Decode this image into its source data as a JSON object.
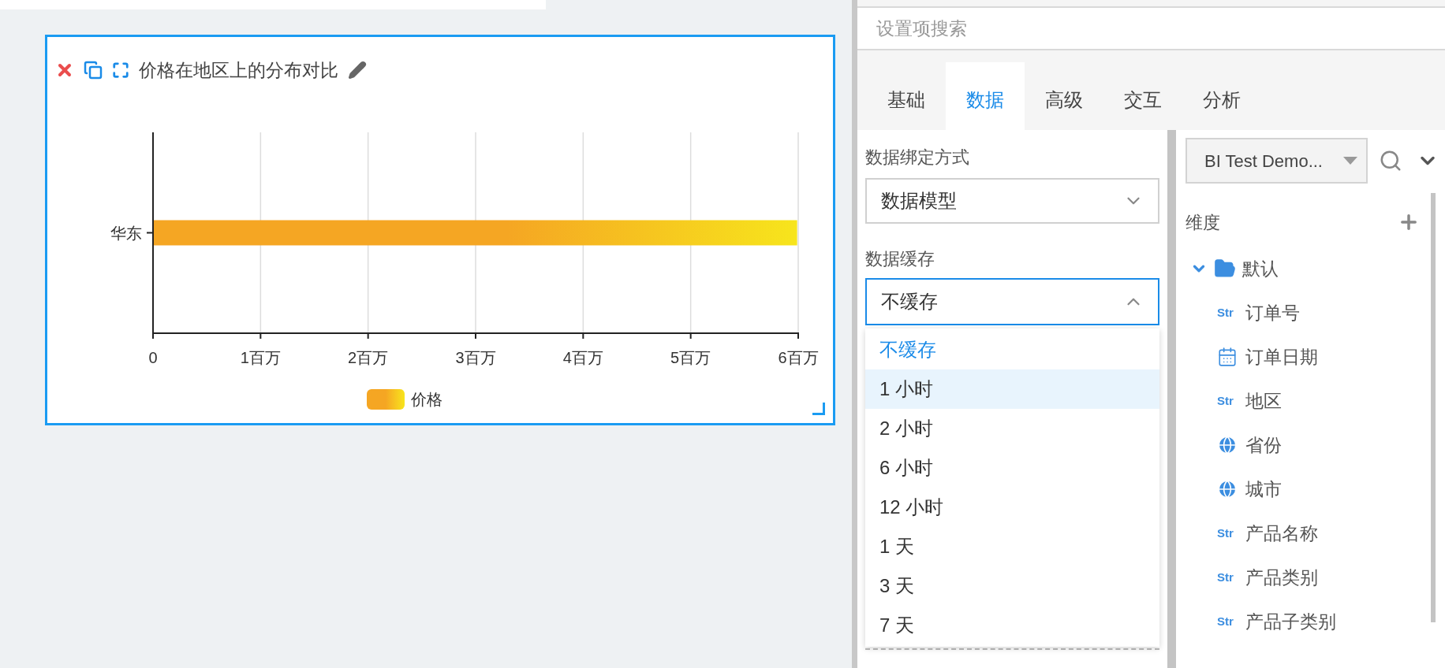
{
  "chart_card": {
    "title": "价格在地区上的分布对比",
    "chart_data": {
      "type": "bar",
      "orientation": "horizontal",
      "categories": [
        "华东"
      ],
      "series": [
        {
          "name": "价格",
          "color": "#f5a623",
          "values": [
            5.99
          ]
        }
      ],
      "xlim": [
        0,
        6
      ],
      "grid": true,
      "xticks": [
        {
          "value": 0,
          "label": "0"
        },
        {
          "value": 1,
          "label": "1百万"
        },
        {
          "value": 2,
          "label": "2百万"
        },
        {
          "value": 3,
          "label": "3百万"
        },
        {
          "value": 4,
          "label": "4百万"
        },
        {
          "value": 5,
          "label": "5百万"
        },
        {
          "value": 6,
          "label": "6百万"
        }
      ]
    }
  },
  "settings": {
    "search": {
      "placeholder": "设置项搜索"
    },
    "tabs": [
      {
        "label": "基础",
        "selected": false
      },
      {
        "label": "数据",
        "selected": true
      },
      {
        "label": "高级",
        "selected": false
      },
      {
        "label": "交互",
        "selected": false
      },
      {
        "label": "分析",
        "selected": false
      }
    ],
    "binding": {
      "label": "数据绑定方式",
      "value": "数据模型"
    },
    "cache": {
      "label": "数据缓存",
      "value": "不缓存",
      "expanded": true,
      "options": [
        {
          "label": "不缓存",
          "selected": true,
          "highlighted": false
        },
        {
          "label": "1 小时",
          "selected": false,
          "highlighted": true
        },
        {
          "label": "2 小时",
          "selected": false,
          "highlighted": false
        },
        {
          "label": "6 小时",
          "selected": false,
          "highlighted": false
        },
        {
          "label": "12 小时",
          "selected": false,
          "highlighted": false
        },
        {
          "label": "1 天",
          "selected": false,
          "highlighted": false
        },
        {
          "label": "3 天",
          "selected": false,
          "highlighted": false
        },
        {
          "label": "7 天",
          "selected": false,
          "highlighted": false
        }
      ]
    },
    "dataset": {
      "value": "BI Test Demo..."
    },
    "dimensions": {
      "title": "维度",
      "folder": {
        "label": "默认",
        "expanded": true,
        "children": [
          {
            "kind": "string",
            "badge": "Str",
            "label": "订单号"
          },
          {
            "kind": "date",
            "label": "订单日期"
          },
          {
            "kind": "string",
            "badge": "Str",
            "label": "地区"
          },
          {
            "kind": "geo",
            "label": "省份"
          },
          {
            "kind": "geo",
            "label": "城市"
          },
          {
            "kind": "string",
            "badge": "Str",
            "label": "产品名称"
          },
          {
            "kind": "string",
            "badge": "Str",
            "label": "产品类别"
          },
          {
            "kind": "string",
            "badge": "Str",
            "label": "产品子类别"
          }
        ]
      }
    }
  }
}
